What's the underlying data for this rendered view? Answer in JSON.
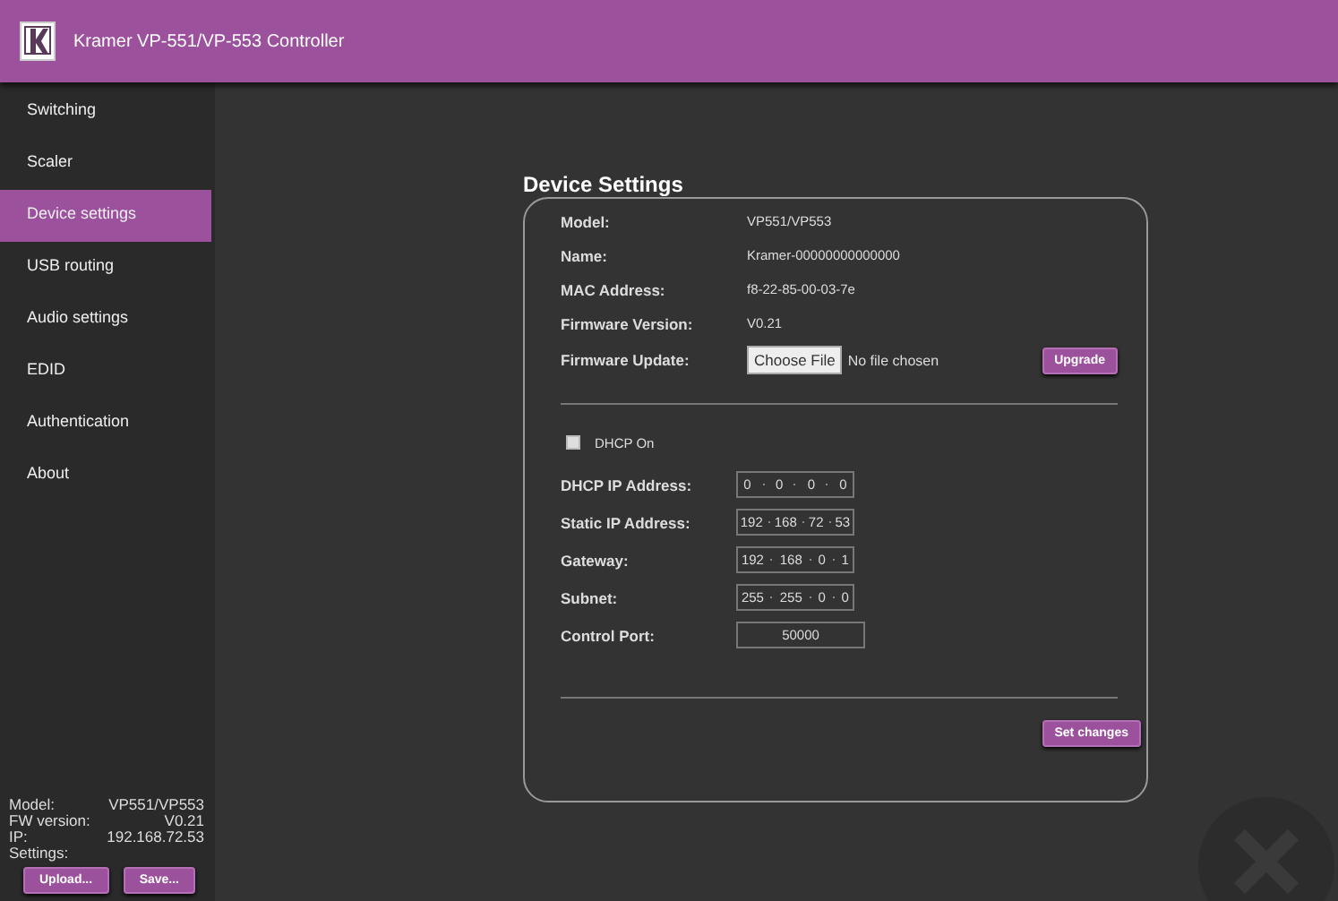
{
  "header": {
    "title": "Kramer VP-551/VP-553 Controller"
  },
  "sidebar": {
    "items": [
      {
        "label": "Switching",
        "selected": false
      },
      {
        "label": "Scaler",
        "selected": false
      },
      {
        "label": "Device settings",
        "selected": true
      },
      {
        "label": "USB routing",
        "selected": false
      },
      {
        "label": "Audio settings",
        "selected": false
      },
      {
        "label": "EDID",
        "selected": false
      },
      {
        "label": "Authentication",
        "selected": false
      },
      {
        "label": "About",
        "selected": false
      }
    ],
    "info": [
      {
        "label": "Model:",
        "value": "VP551/VP553"
      },
      {
        "label": "FW version:",
        "value": "V0.21"
      },
      {
        "label": "IP:",
        "value": "192.168.72.53"
      }
    ],
    "settings_label": "Settings:",
    "buttons": [
      "Upload...",
      "Save..."
    ]
  },
  "panel": {
    "title": "Device Settings",
    "info": [
      {
        "label": "Model:",
        "value": "VP551/VP553"
      },
      {
        "label": "Name:",
        "value": "Kramer-00000000000000"
      },
      {
        "label": "MAC Address:",
        "value": "f8-22-85-00-03-7e"
      },
      {
        "label": "Firmware Version:",
        "value": "V0.21"
      }
    ],
    "firmware_update": {
      "label": "Firmware Update:",
      "choose_button": "Choose File",
      "file_status": "No file chosen",
      "upgrade_button": "Upgrade"
    },
    "dhcp": {
      "label": "DHCP On",
      "checked": false
    },
    "network": [
      {
        "label": "DHCP IP Address:",
        "octets": [
          "0",
          "0",
          "0",
          "0"
        ]
      },
      {
        "label": "Static IP Address:",
        "octets": [
          "192",
          "168",
          "72",
          "53"
        ]
      },
      {
        "label": "Gateway:",
        "octets": [
          "192",
          "168",
          "0",
          "1"
        ]
      },
      {
        "label": "Subnet:",
        "octets": [
          "255",
          "255",
          "0",
          "0"
        ]
      }
    ],
    "control_port": {
      "label": "Control Port:",
      "value": "50000"
    },
    "submit_button": "Set changes"
  }
}
